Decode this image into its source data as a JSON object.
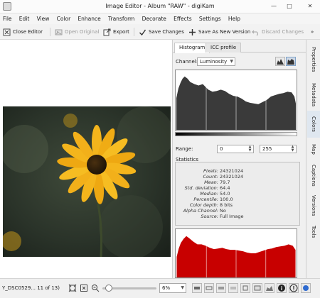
{
  "window": {
    "title": "Image Editor - Album \"RAW\" - digiKam"
  },
  "window_controls": {
    "minimize": "—",
    "maximize": "□",
    "close": "✕"
  },
  "menu": [
    "File",
    "Edit",
    "View",
    "Color",
    "Enhance",
    "Transform",
    "Decorate",
    "Effects",
    "Settings",
    "Help"
  ],
  "toolbar": {
    "close_editor": "Close Editor",
    "open_original": "Open Original",
    "export": "Export",
    "save_changes": "Save Changes",
    "save_as_new_version": "Save As New Version",
    "discard_changes": "Discard Changes",
    "overflow": "»"
  },
  "histogram_panel": {
    "tabs": [
      "Histogram",
      "ICC profile"
    ],
    "active_tab": "Histogram",
    "channel_label": "Channel:",
    "channel_value": "Luminosity",
    "range_label": "Range:",
    "range_min": "0",
    "range_max": "255",
    "statistics_title": "Statistics",
    "stats": [
      {
        "key": "Pixels:",
        "value": "24321024"
      },
      {
        "key": "Count:",
        "value": "24321024"
      },
      {
        "key": "Mean:",
        "value": "79.7"
      },
      {
        "key": "Std. deviation:",
        "value": "64.4"
      },
      {
        "key": "Median:",
        "value": "54.0"
      },
      {
        "key": "Percentile:",
        "value": "100.0"
      },
      {
        "key": "Color depth:",
        "value": "8 bits"
      },
      {
        "key": "Alpha Channel:",
        "value": "No"
      },
      {
        "key": "Source:",
        "value": "Full Image"
      }
    ],
    "colors": {
      "luminosity_fill": "#3a3a3a",
      "red_fill": "#c80000"
    }
  },
  "side_tabs": [
    "Properties",
    "Metadata",
    "Colors",
    "Map",
    "Captions",
    "Versions",
    "Tools"
  ],
  "active_side_tab": "Colors",
  "status": {
    "file": "Y_DSC0529... 11 of 13)",
    "zoom": "6%",
    "zoom_level": 0.06
  },
  "icons": {
    "close_editor": "close-editor-icon",
    "open_original": "open-original-icon",
    "export": "export-icon",
    "save": "checkmark-icon",
    "save_as_new": "plus-icon",
    "discard": "undo-icon"
  }
}
